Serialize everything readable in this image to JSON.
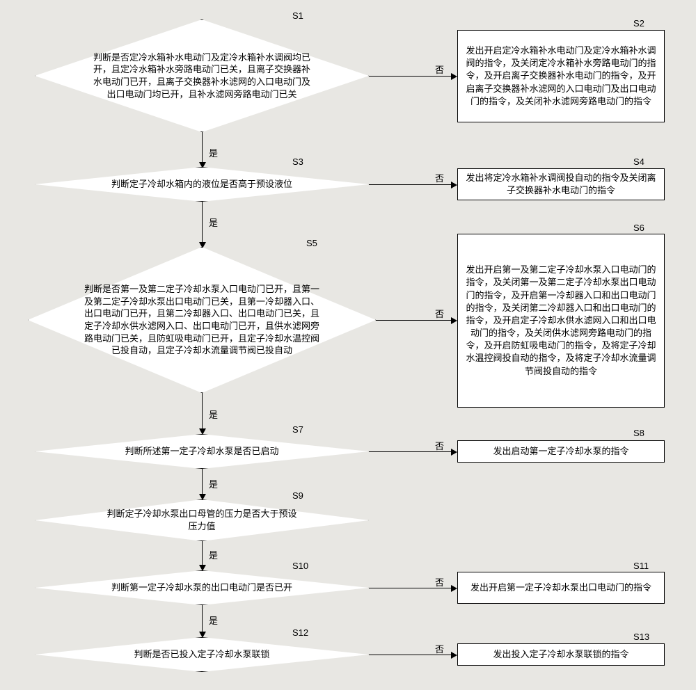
{
  "labels": {
    "yes": "是",
    "no": "否"
  },
  "steps": {
    "s1": {
      "tag": "S1",
      "text": "判断是否定冷水箱补水电动门及定冷水箱补水调阀均已开，且定冷水箱补水旁路电动门已关，且离子交换器补水电动门已开，且离子交换器补水滤网的入口电动门及出口电动门均已开，且补水滤网旁路电动门已关"
    },
    "s2": {
      "tag": "S2",
      "text": "发出开启定冷水箱补水电动门及定冷水箱补水调阀的指令，及关闭定冷水箱补水旁路电动门的指令，及开启离子交换器补水电动门的指令，及开启离子交换器补水滤网的入口电动门及出口电动门的指令，及关闭补水滤网旁路电动门的指令"
    },
    "s3": {
      "tag": "S3",
      "text": "判断定子冷却水箱内的液位是否高于预设液位"
    },
    "s4": {
      "tag": "S4",
      "text": "发出将定冷水箱补水调阀投自动的指令及关闭离子交换器补水电动门的指令"
    },
    "s5": {
      "tag": "S5",
      "text": "判断是否第一及第二定子冷却水泵入口电动门已开，且第一及第二定子冷却水泵出口电动门已关，且第一冷却器入口、出口电动门已开，且第二冷却器入口、出口电动门已关，且定子冷却水供水滤网入口、出口电动门已开，且供水滤网旁路电动门已关，且防虹吸电动门已开，且定子冷却水温控阀已投自动，且定子冷却水流量调节阀已投自动"
    },
    "s6": {
      "tag": "S6",
      "text": "发出开启第一及第二定子冷却水泵入口电动门的指令，及关闭第一及第二定子冷却水泵出口电动门的指令，及开启第一冷却器入口和出口电动门的指令，及关闭第二冷却器入口和出口电动门的指令，及开启定子冷却水供水滤网入口和出口电动门的指令，及关闭供水滤网旁路电动门的指令，及开启防虹吸电动门的指令，及将定子冷却水温控阀投自动的指令，及将定子冷却水流量调节阀投自动的指令"
    },
    "s7": {
      "tag": "S7",
      "text": "判断所述第一定子冷却水泵是否已启动"
    },
    "s8": {
      "tag": "S8",
      "text": "发出启动第一定子冷却水泵的指令"
    },
    "s9": {
      "tag": "S9",
      "text": "判断定子冷却水泵出口母管的压力是否大于预设压力值"
    },
    "s10": {
      "tag": "S10",
      "text": "判断第一定子冷却水泵的出口电动门是否已开"
    },
    "s11": {
      "tag": "S11",
      "text": "发出开启第一定子冷却水泵出口电动门的指令"
    },
    "s12": {
      "tag": "S12",
      "text": "判断是否已投入定子冷却水泵联锁"
    },
    "s13": {
      "tag": "S13",
      "text": "发出投入定子冷却水泵联锁的指令"
    }
  }
}
